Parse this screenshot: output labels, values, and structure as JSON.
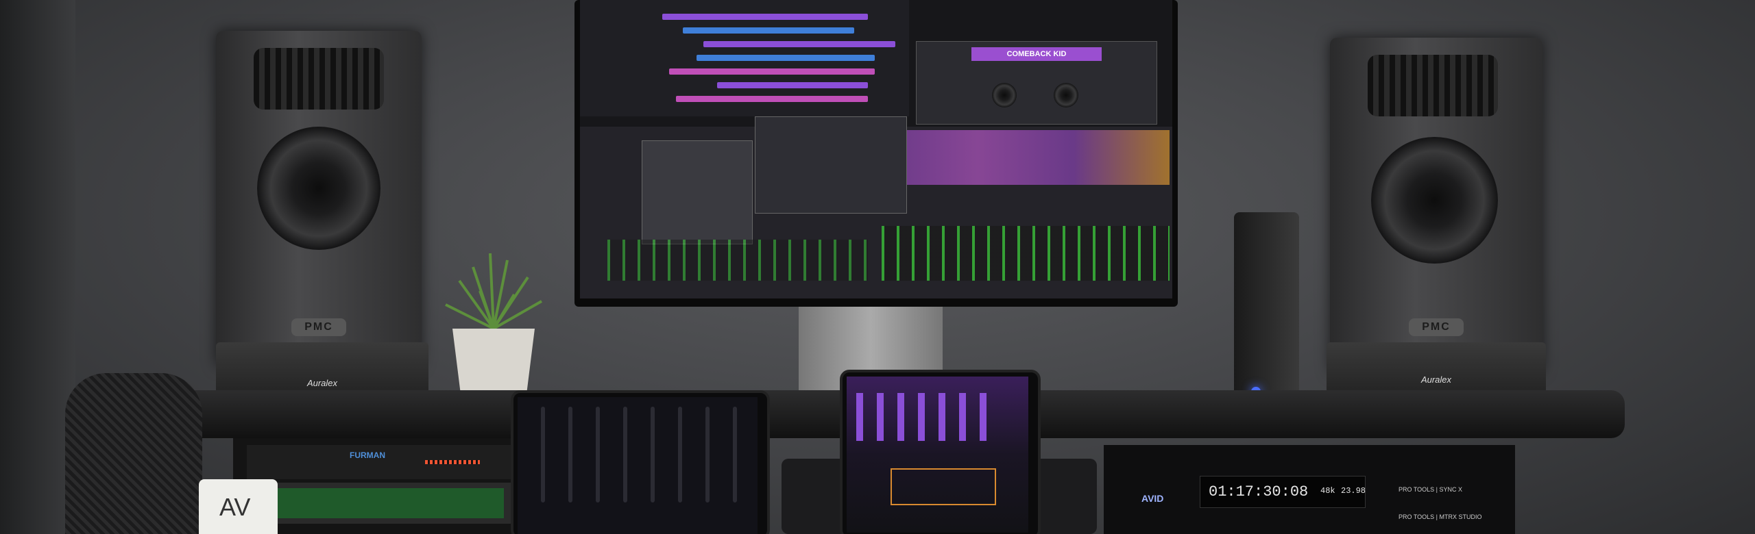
{
  "scene": {
    "speaker_left_brand": "PMC",
    "speaker_right_brand": "PMC",
    "stand_left_brand": "Auralex",
    "stand_right_brand": "Auralex",
    "plugin_title": "COMEBACK KID",
    "rack_brand": "FURMAN",
    "timecode": "01:17:30:08",
    "sample_rate": "48k",
    "frame_rate": "23.98",
    "rack_right_label_1": "PRO TOOLS | SYNC X",
    "rack_right_label_2": "PRO TOOLS | MTRX STUDIO",
    "brand_logo": "AVID",
    "mug_logo": "AV"
  },
  "colors": {
    "track_purple": "#8b4fd8",
    "track_blue": "#3f7fd9",
    "track_magenta": "#c04fb8",
    "meter_green": "#3cd63a",
    "led_blue": "#4a6dff"
  }
}
